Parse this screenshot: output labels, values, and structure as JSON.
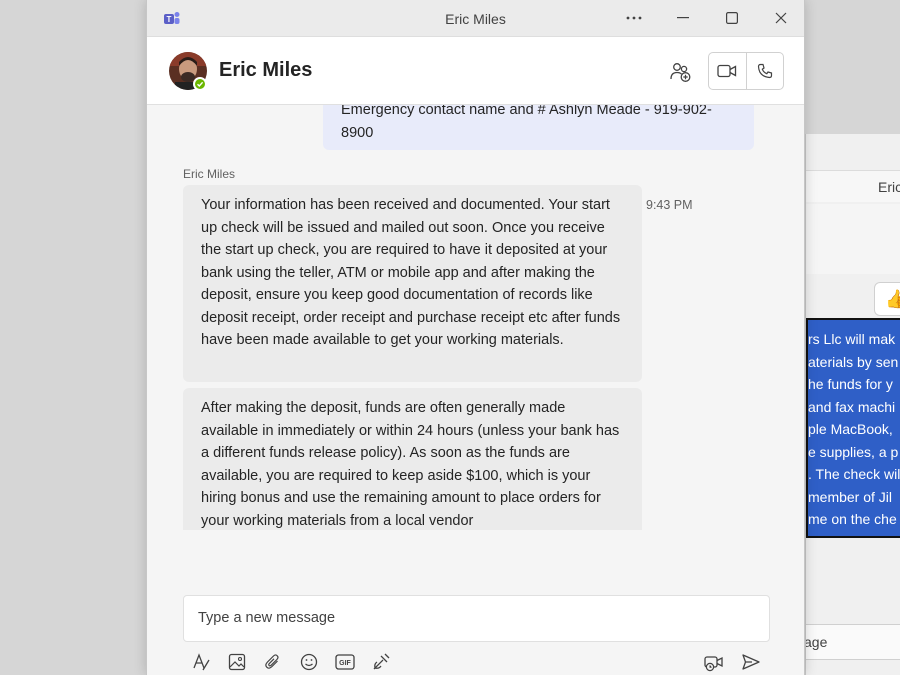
{
  "window": {
    "title": "Eric Miles"
  },
  "header": {
    "contact_name": "Eric Miles"
  },
  "messages": {
    "sent_text": "Emergency contact name and # Ashlyn Meade - 919-902-8900",
    "sender_name": "Eric Miles",
    "timestamp": "9:43 PM",
    "received": [
      "Your information has been received and documented. Your start up check will be issued and mailed out soon. Once you receive the start up check, you are required to have it deposited at your bank using the teller, ATM or mobile app and after making the deposit, ensure you keep good documentation of records like deposit receipt, order receipt and purchase receipt etc after funds have been made available to get your working materials.",
      "After making the deposit, funds are often generally made available in immediately or within 24 hours (unless your bank has a different funds release policy). As soon as the funds are available, you are required to keep aside $100, which is your hiring bonus and use the remaining amount to place orders for your working materials from a local vendor"
    ]
  },
  "compose": {
    "placeholder": "Type a new message"
  },
  "background_window": {
    "title": "Eric",
    "lines": [
      "rs Llc will mak",
      "aterials by sen",
      "he funds for y",
      "and fax machi",
      "ple MacBook,",
      "e supplies, a p",
      ". The check wil",
      "member of Jil",
      "me on the che"
    ],
    "compose_text": "age"
  },
  "colors": {
    "accent": "#5b5fc7",
    "presence": "#6bb700",
    "sent_bubble": "#e8ebfa",
    "received_bubble": "#ebebeb",
    "selection": "#2f5fc7"
  }
}
